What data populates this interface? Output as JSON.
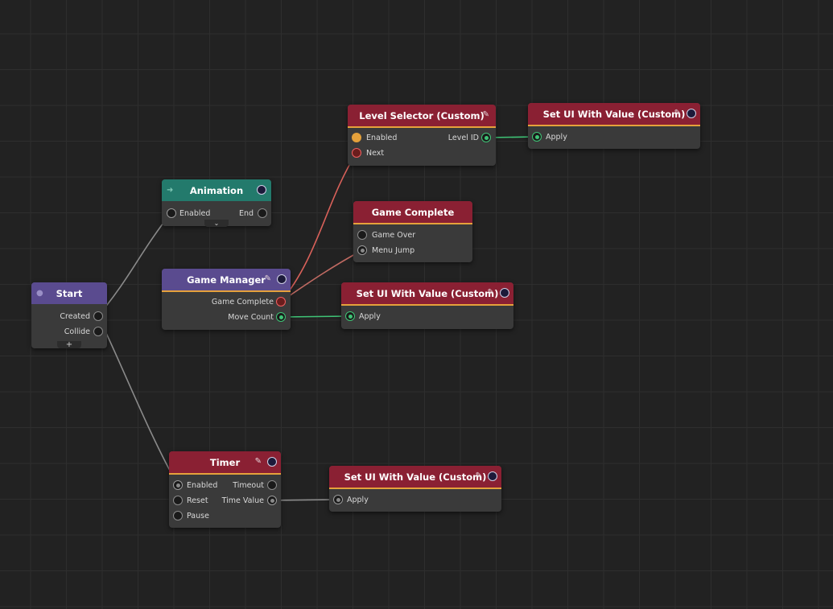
{
  "nodes": {
    "start": {
      "title": "Start",
      "outputs": [
        "Created",
        "Collide"
      ],
      "add_label": "+"
    },
    "animation": {
      "title": "Animation",
      "inputs": [
        "Enabled"
      ],
      "outputs": [
        "End"
      ],
      "expand_label": "⌄"
    },
    "game_manager": {
      "title": "Game Manager",
      "outputs": [
        "Game Complete",
        "Move Count"
      ]
    },
    "level_selector": {
      "title": "Level Selector (Custom)",
      "inputs": [
        "Enabled",
        "Next"
      ],
      "outputs": [
        "Level ID"
      ]
    },
    "game_complete": {
      "title": "Game Complete",
      "inputs": [
        "Game Over",
        "Menu Jump"
      ]
    },
    "set_ui_1": {
      "title": "Set UI With Value (Custom)",
      "inputs": [
        "Apply"
      ]
    },
    "set_ui_2": {
      "title": "Set UI With Value (Custom)",
      "inputs": [
        "Apply"
      ]
    },
    "timer": {
      "title": "Timer",
      "inputs": [
        "Enabled",
        "Reset",
        "Pause"
      ],
      "outputs": [
        "Timeout",
        "Time Value"
      ]
    },
    "set_ui_3": {
      "title": "Set UI With Value (Custom)",
      "inputs": [
        "Apply"
      ]
    }
  },
  "icons": {
    "edit": "pencil-icon",
    "options": "circle-options-icon",
    "animation_left": "arrow-right-icon"
  },
  "colors": {
    "background": "#222222",
    "grid": "#2e2e2e",
    "node_body": "#3a3a3a",
    "header_red": "#8a2033",
    "header_purple": "#5a4b8f",
    "header_teal": "#237a6c",
    "accent_orange": "#e5a13b",
    "wire_gray": "#8a8a8a",
    "wire_red": "#d9615a",
    "wire_green": "#3fc476"
  }
}
